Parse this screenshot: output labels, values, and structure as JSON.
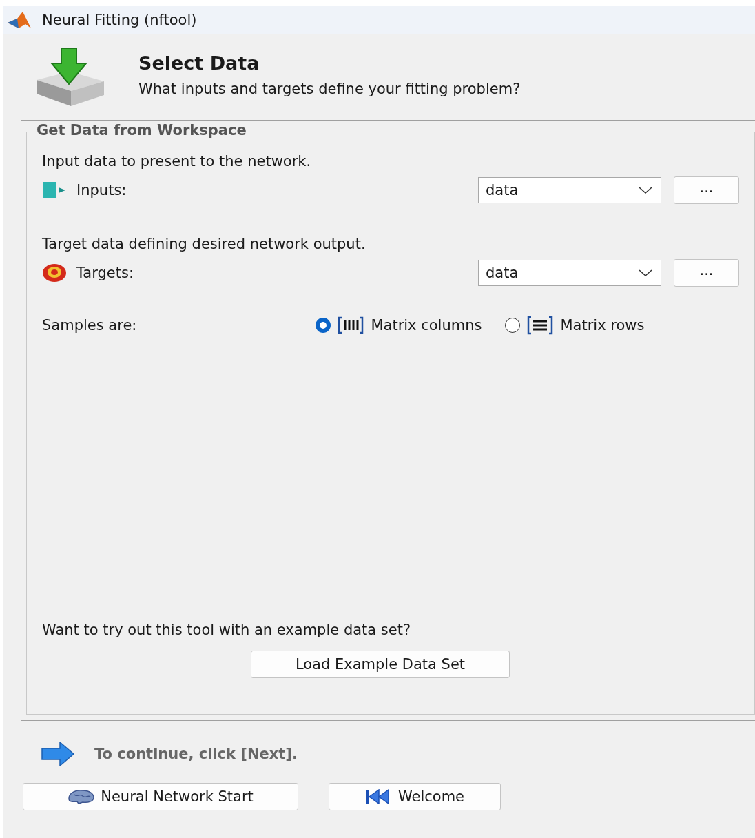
{
  "window": {
    "title": "Neural Fitting (nftool)"
  },
  "header": {
    "title": "Select Data",
    "subtitle": "What inputs and targets define your fitting problem?"
  },
  "group": {
    "title": "Get Data from Workspace",
    "fields": [
      {
        "hint": "Input data to present to the network.",
        "label": "Inputs:",
        "kind": "inputs",
        "value": "data",
        "browse": "..."
      },
      {
        "hint": "Target data defining desired network output.",
        "label": "Targets:",
        "kind": "targets",
        "value": "data",
        "browse": "..."
      }
    ],
    "samples": {
      "label": "Samples are:",
      "options": [
        {
          "label": "Matrix columns",
          "kind": "columns",
          "selected": true
        },
        {
          "label": "Matrix rows",
          "kind": "rows",
          "selected": false
        }
      ]
    },
    "example": {
      "prompt": "Want to try out this tool with an example data set?",
      "button": "Load Example Data Set"
    }
  },
  "hint": "To continue, click [Next].",
  "buttons": [
    {
      "label": "Neural Network Start",
      "kind": "start"
    },
    {
      "label": "Welcome",
      "kind": "welcome"
    }
  ]
}
